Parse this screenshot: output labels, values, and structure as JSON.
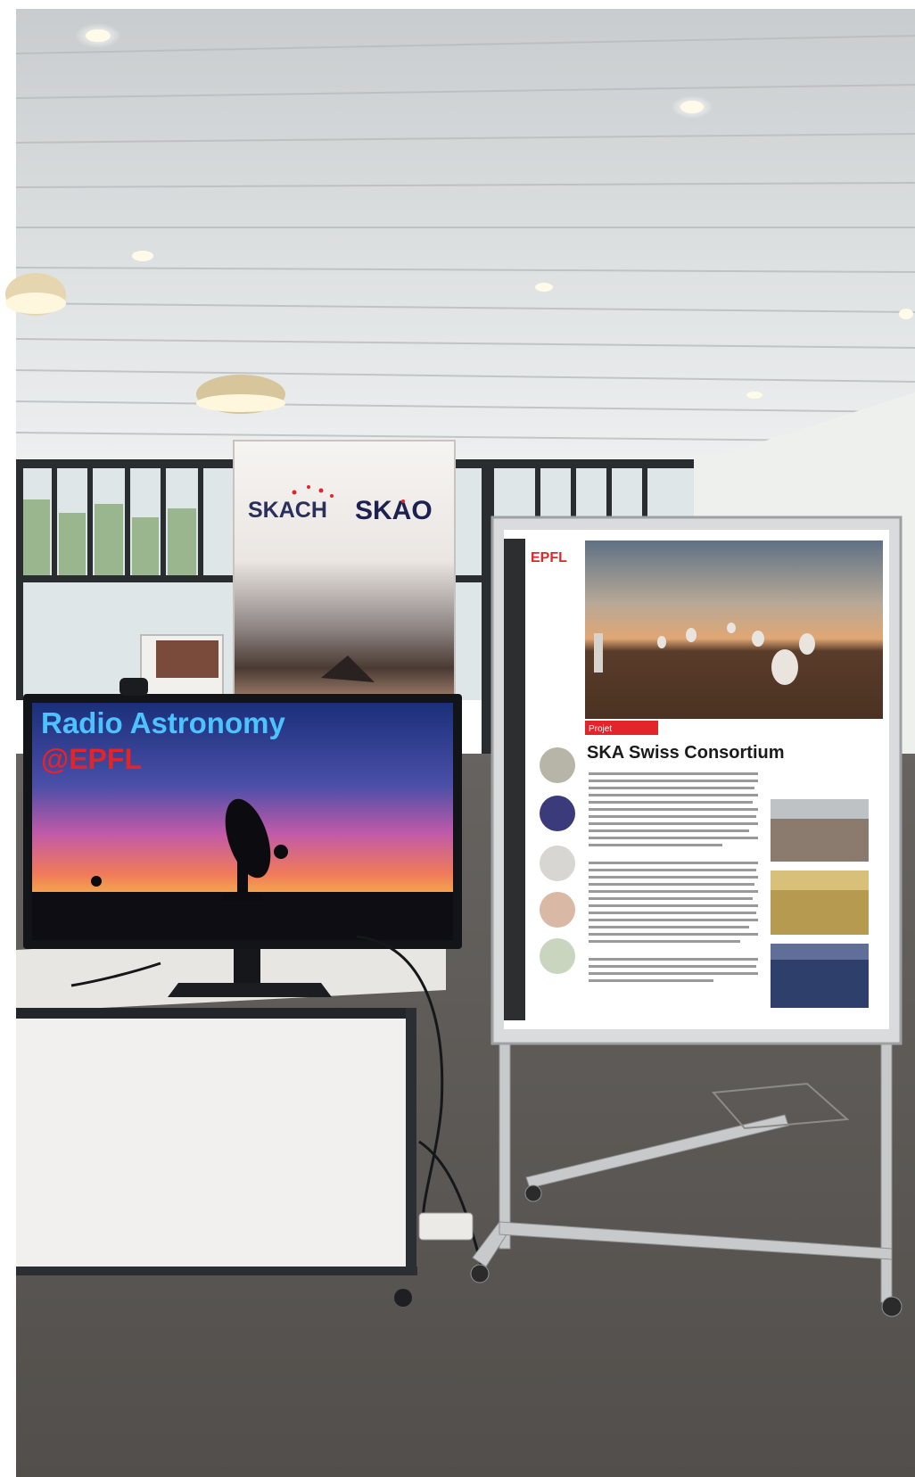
{
  "scene": {
    "description_kind": "photo",
    "colors": {
      "epfl_red": "#e3242b",
      "monitor_title_blue": "#4cc3ff",
      "carpet": "#5f5c59",
      "ceiling": "#d9dcde"
    }
  },
  "monitor": {
    "title_line1": "Radio Astronomy",
    "title_line2": "@EPFL"
  },
  "banner": {
    "logo_left": "SKACH",
    "logo_right": "SKAO"
  },
  "poster": {
    "brand": "EPFL",
    "tag": "Projet",
    "heading": "SKA Swiss Consortium"
  }
}
